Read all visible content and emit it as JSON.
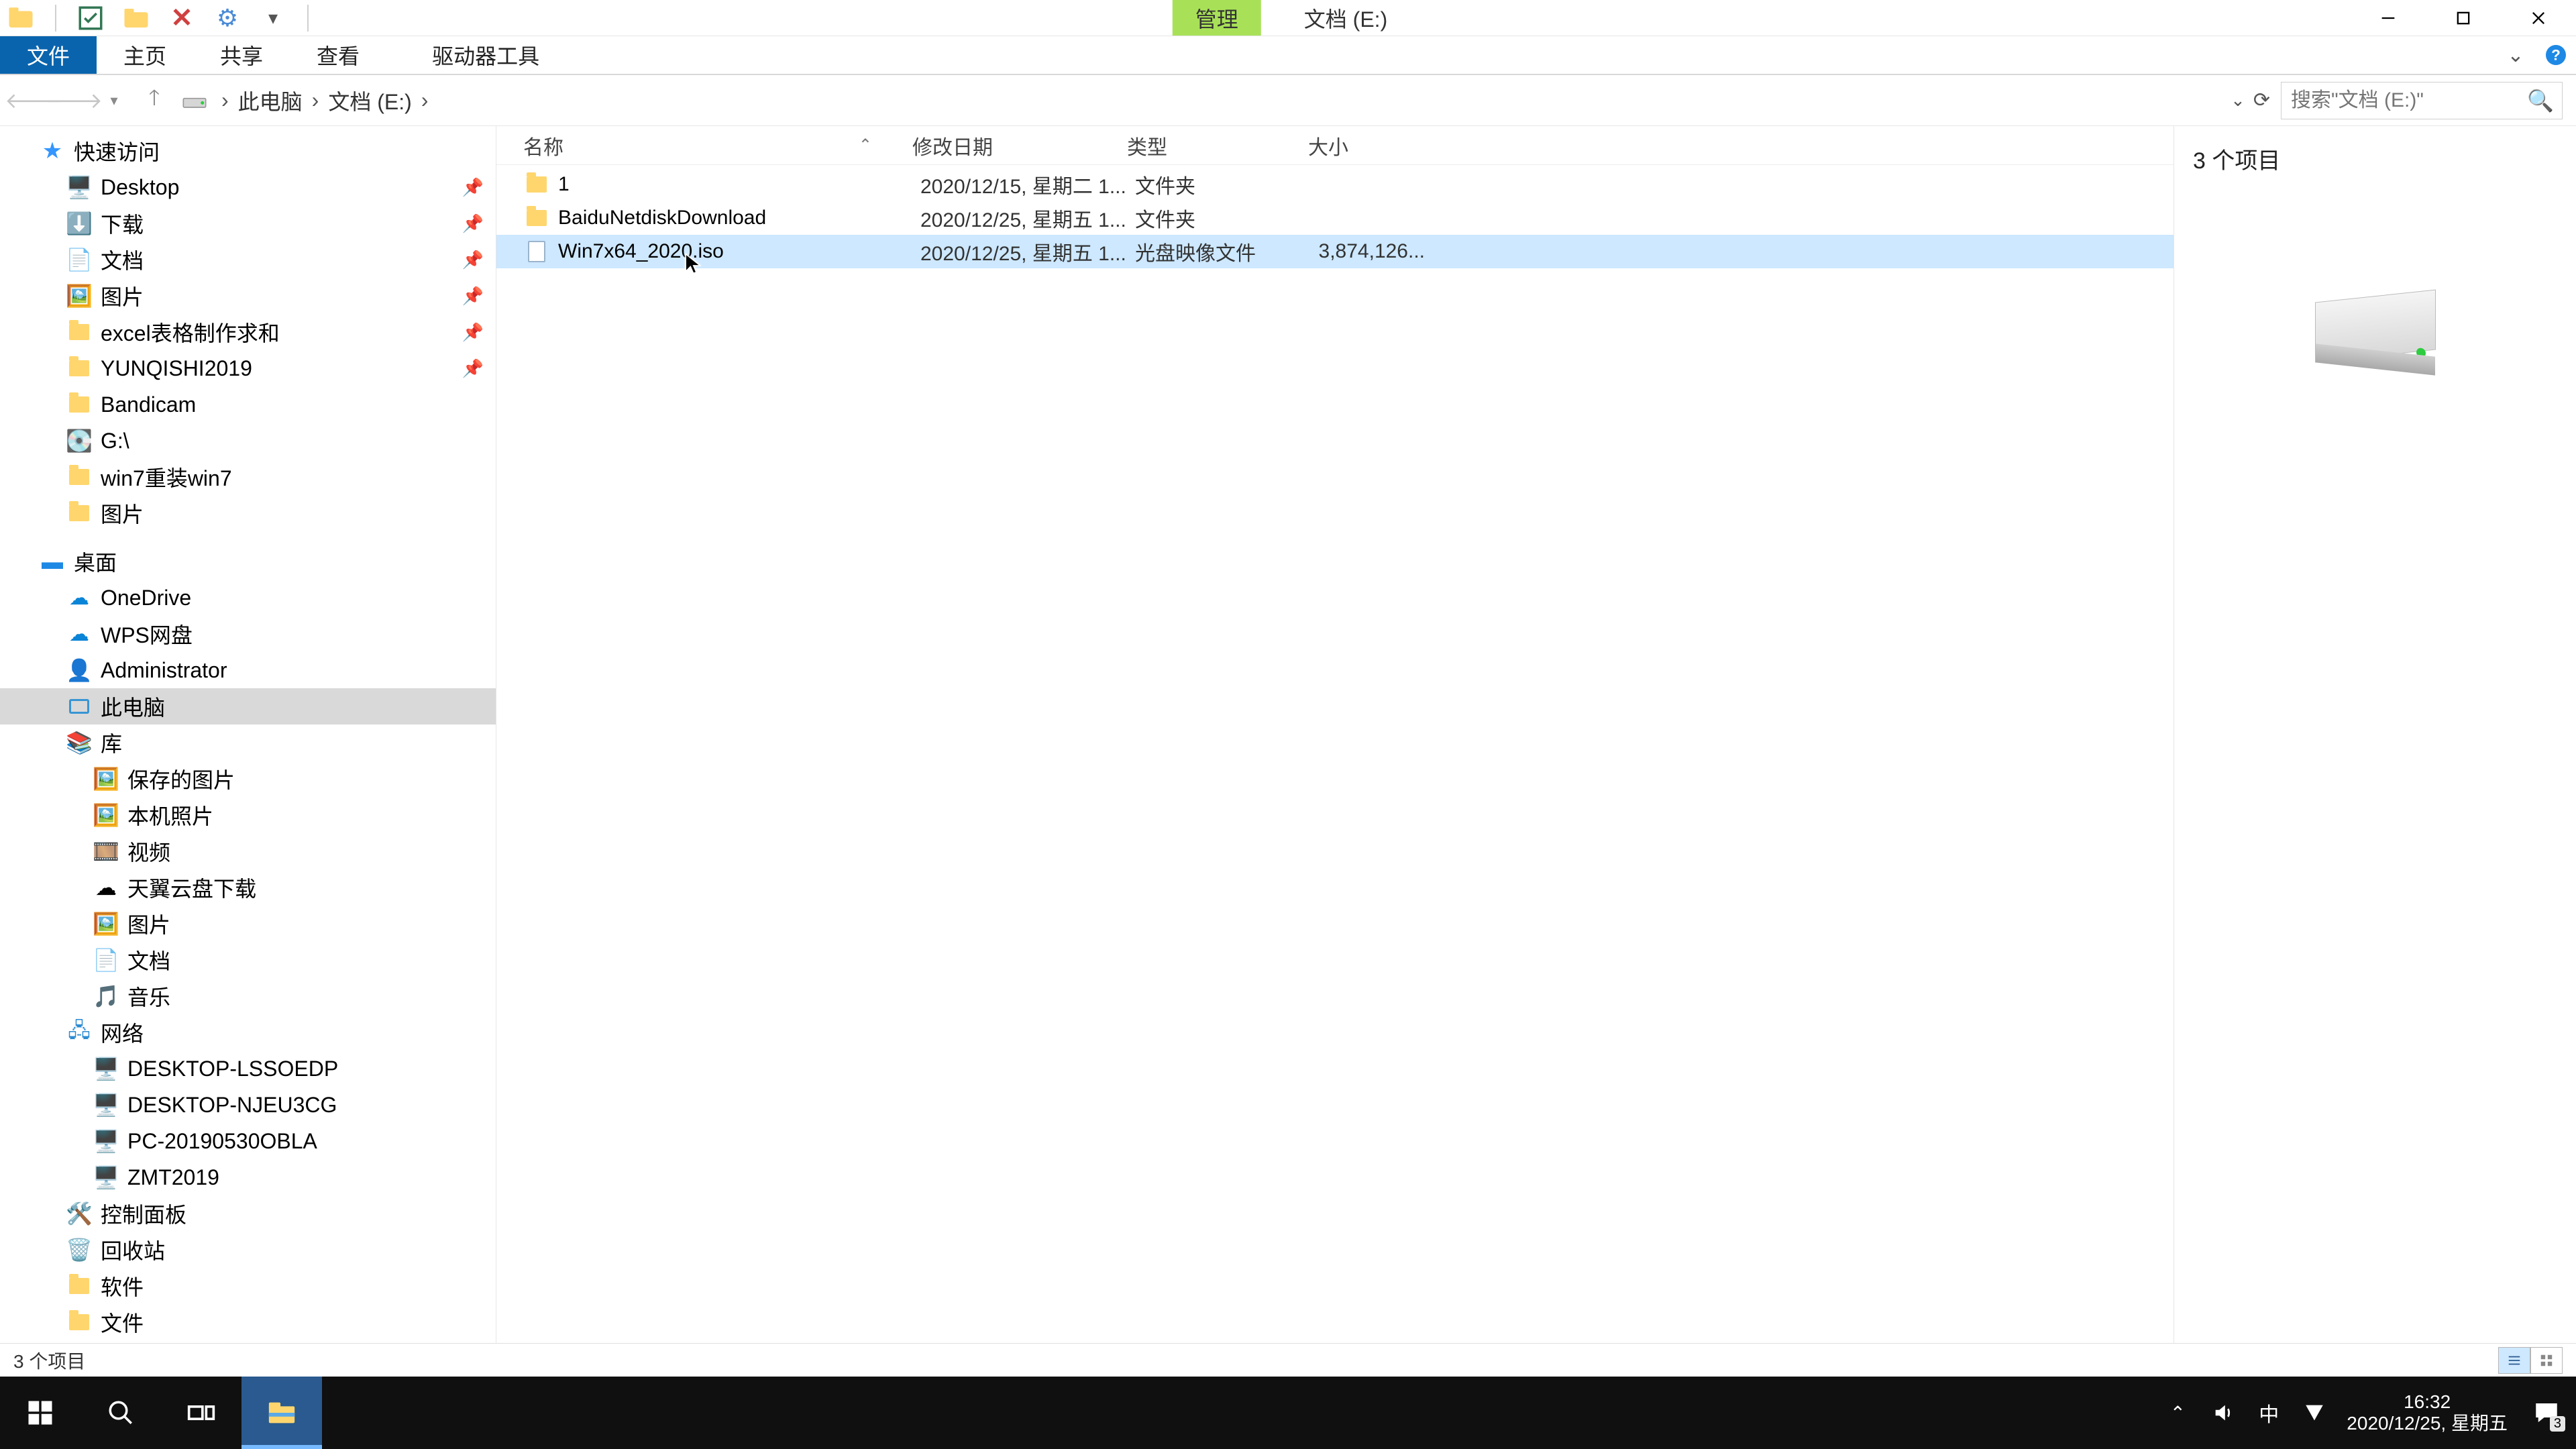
{
  "titlebar": {
    "contextual_tab": "管理",
    "window_title": "文档 (E:)"
  },
  "ribbon": {
    "file": "文件",
    "home": "主页",
    "share": "共享",
    "view": "查看",
    "drive_tools": "驱动器工具"
  },
  "breadcrumb": {
    "seg1": "此电脑",
    "seg2": "文档 (E:)"
  },
  "search": {
    "placeholder": "搜索\"文档 (E:)\""
  },
  "tree": {
    "quick_access": "快速访问",
    "desktop": "Desktop",
    "downloads": "下载",
    "documents": "文档",
    "pictures": "图片",
    "excel": "excel表格制作求和",
    "yunqishi": "YUNQISHI2019",
    "bandicam": "Bandicam",
    "gdrive": "G:\\",
    "win7": "win7重装win7",
    "pictures2": "图片",
    "desktop_root": "桌面",
    "onedrive": "OneDrive",
    "wps": "WPS网盘",
    "admin": "Administrator",
    "pc": "此电脑",
    "library": "库",
    "saved_pics": "保存的图片",
    "camera_roll": "本机照片",
    "videos": "视频",
    "tianyi": "天翼云盘下载",
    "pictures3": "图片",
    "docs3": "文档",
    "music": "音乐",
    "network": "网络",
    "net1": "DESKTOP-LSSOEDP",
    "net2": "DESKTOP-NJEU3CG",
    "net3": "PC-20190530OBLA",
    "net4": "ZMT2019",
    "control_panel": "控制面板",
    "recycle": "回收站",
    "software": "软件",
    "files": "文件"
  },
  "columns": {
    "name": "名称",
    "date": "修改日期",
    "type": "类型",
    "size": "大小"
  },
  "rows": [
    {
      "name": "1",
      "date": "2020/12/15, 星期二 1...",
      "type": "文件夹",
      "size": ""
    },
    {
      "name": "BaiduNetdiskDownload",
      "date": "2020/12/25, 星期五 1...",
      "type": "文件夹",
      "size": ""
    },
    {
      "name": "Win7x64_2020.iso",
      "date": "2020/12/25, 星期五 1...",
      "type": "光盘映像文件",
      "size": "3,874,126..."
    }
  ],
  "preview": {
    "count": "3 个项目"
  },
  "status": {
    "text": "3 个项目"
  },
  "taskbar": {
    "time": "16:32",
    "date": "2020/12/25, 星期五",
    "ime": "中",
    "notif_count": "3"
  }
}
